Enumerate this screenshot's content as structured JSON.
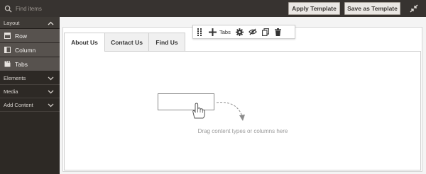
{
  "topbar": {
    "search_placeholder": "Find items",
    "apply_template_label": "Apply Template",
    "save_template_label": "Save as Template"
  },
  "sidebar": {
    "header": "Layout",
    "items": [
      {
        "label": "Row",
        "icon": "row-icon"
      },
      {
        "label": "Column",
        "icon": "column-icon"
      },
      {
        "label": "Tabs",
        "icon": "tabs-icon"
      }
    ],
    "sections": [
      {
        "label": "Elements"
      },
      {
        "label": "Media"
      },
      {
        "label": "Add Content"
      }
    ]
  },
  "toolbar": {
    "label": "Tabs",
    "icons": [
      "drag-handle-icon",
      "add-icon",
      "settings-icon",
      "hide-icon",
      "duplicate-icon",
      "delete-icon"
    ]
  },
  "tabs": [
    {
      "label": "About Us",
      "active": true
    },
    {
      "label": "Contact Us",
      "active": false
    },
    {
      "label": "Find Us",
      "active": false
    }
  ],
  "empty_state": {
    "text": "Drag content types or columns here"
  },
  "colors": {
    "topbar": "#373330",
    "sidebar": "#2d2925",
    "sidebar_item": "#57524e",
    "button_bg": "#eae7e4"
  }
}
